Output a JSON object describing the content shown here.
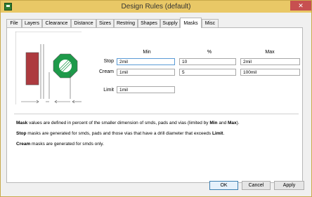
{
  "window": {
    "title": "Design Rules (default)",
    "close_glyph": "✕"
  },
  "tabs": [
    "File",
    "Layers",
    "Clearance",
    "Distance",
    "Sizes",
    "Restring",
    "Shapes",
    "Supply",
    "Masks",
    "Misc"
  ],
  "active_tab": "Masks",
  "columns": {
    "min": "Min",
    "pct": "%",
    "max": "Max"
  },
  "rows": {
    "stop": {
      "label": "Stop",
      "min": "2mil",
      "pct": "10",
      "max": "2mil"
    },
    "cream": {
      "label": "Cream",
      "min": "1mil",
      "pct": "5",
      "max": "100mil"
    },
    "limit": {
      "label": "Limit",
      "value": "1mil"
    }
  },
  "notes": {
    "mask": {
      "b1": "Mask",
      "t1": " values are defined in percent of the smaller dimension of smds, pads and vias (limited by ",
      "b2": "Min",
      "t2": " and ",
      "b3": "Max",
      "t3": ")."
    },
    "stop": {
      "b1": "Stop",
      "t1": " masks are generated for smds, pads and those vias that have a drill diameter that exceeds ",
      "b2": "Limit",
      "t2": "."
    },
    "cream": {
      "b1": "Cream",
      "t1": " masks are generated for smds only."
    }
  },
  "buttons": {
    "ok": "OK",
    "cancel": "Cancel",
    "apply": "Apply"
  },
  "colors": {
    "pad_fill": "#ad3a3f",
    "octagon": "#1e9a4a",
    "titlebar": "#e9c866",
    "close": "#c75050"
  }
}
